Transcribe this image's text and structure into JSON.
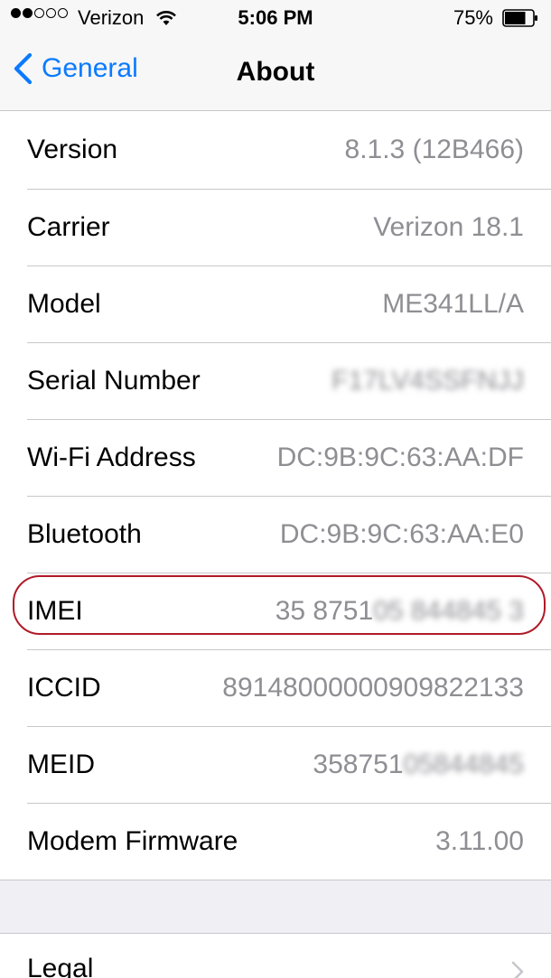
{
  "status_bar": {
    "signal_bars": 2,
    "signal_total": 5,
    "carrier": "Verizon",
    "wifi_icon": "wifi-icon",
    "time": "5:06 PM",
    "battery_percent": "75%",
    "battery_level": 0.75
  },
  "nav": {
    "back_label": "General",
    "title": "About"
  },
  "rows": {
    "version": {
      "label": "Version",
      "value": "8.1.3 (12B466)"
    },
    "carrier": {
      "label": "Carrier",
      "value": "Verizon 18.1"
    },
    "model": {
      "label": "Model",
      "value": "ME341LL/A"
    },
    "serial": {
      "label": "Serial Number",
      "value": "F17LV4SSFNJJ"
    },
    "wifi": {
      "label": "Wi-Fi Address",
      "value": "DC:9B:9C:63:AA:DF"
    },
    "bluetooth": {
      "label": "Bluetooth",
      "value": "DC:9B:9C:63:AA:E0"
    },
    "imei": {
      "label": "IMEI",
      "value_visible": "35 8751",
      "value_blurred": "05 844845 3"
    },
    "iccid": {
      "label": "ICCID",
      "value": "89148000000909822133"
    },
    "meid": {
      "label": "MEID",
      "value_visible": "358751",
      "value_blurred": "05844845"
    },
    "modem": {
      "label": "Modem Firmware",
      "value": "3.11.00"
    }
  },
  "legal": {
    "label": "Legal"
  },
  "colors": {
    "accent": "#0a7aff",
    "secondary_text": "#8e8e93",
    "highlight": "#b01a28",
    "background": "#efeff4",
    "separator": "#c8c7cc"
  }
}
